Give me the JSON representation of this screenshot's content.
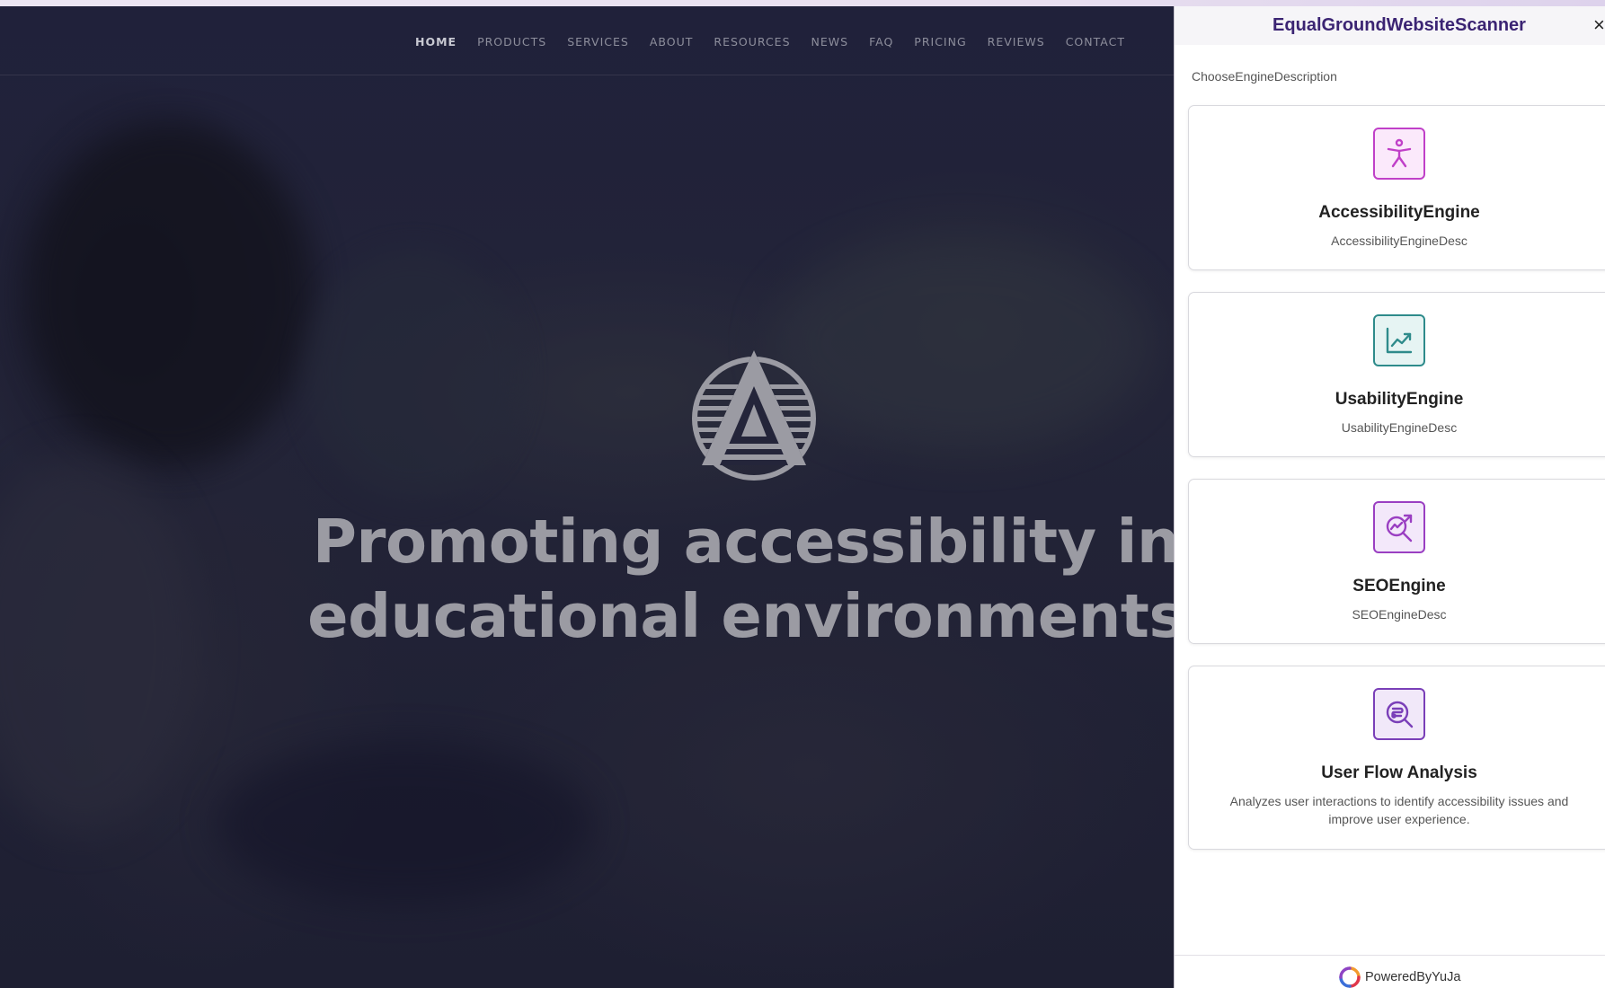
{
  "website": {
    "nav": [
      "HOME",
      "PRODUCTS",
      "SERVICES",
      "ABOUT",
      "RESOURCES",
      "NEWS",
      "FAQ",
      "PRICING",
      "REVIEWS",
      "CONTACT"
    ],
    "hero_title_line1": "Promoting accessibility in",
    "hero_title_line2": "educational environments"
  },
  "scanner": {
    "title": "EqualGroundWebsiteScanner",
    "close_label": "×",
    "subtitle": "ChooseEngineDescription",
    "engines": [
      {
        "name": "AccessibilityEngine",
        "desc": "AccessibilityEngineDesc",
        "icon": "accessibility-icon",
        "color": "#c040c8",
        "bg": "#fbe9fb"
      },
      {
        "name": "UsabilityEngine",
        "desc": "UsabilityEngineDesc",
        "icon": "chart-trending-up-icon",
        "color": "#2e8b8b",
        "bg": "#e6f4f3"
      },
      {
        "name": "SEOEngine",
        "desc": "SEOEngineDesc",
        "icon": "search-target-icon",
        "color": "#9a3fc2",
        "bg": "#f3e8fa"
      },
      {
        "name": "User Flow Analysis",
        "desc": "Analyzes user interactions to identify accessibility issues and improve user experience.",
        "icon": "flow-search-icon",
        "color": "#7a3fb8",
        "bg": "#f1e8f9"
      }
    ],
    "footer": {
      "powered_by": "PoweredByYuJa"
    }
  }
}
